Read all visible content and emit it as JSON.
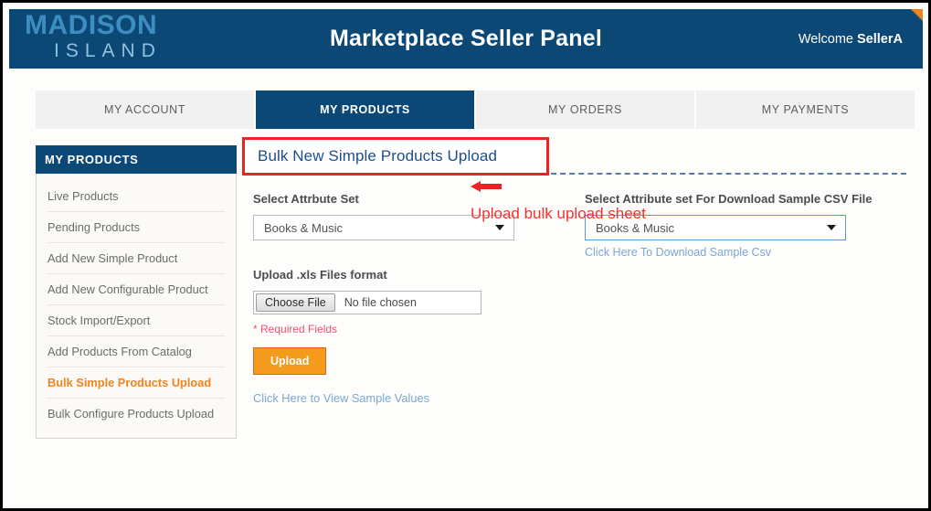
{
  "header": {
    "logo_main": "MADISON",
    "logo_sub": "ISLAND",
    "title": "Marketplace Seller Panel",
    "welcome_prefix": "Welcome ",
    "welcome_user": "SellerA",
    "bg_color": "#0c4876",
    "corner_accent_color": "#f08421"
  },
  "tabs": [
    {
      "label": "MY ACCOUNT",
      "active": false
    },
    {
      "label": "MY PRODUCTS",
      "active": true
    },
    {
      "label": "MY ORDERS",
      "active": false
    },
    {
      "label": "MY PAYMENTS",
      "active": false
    }
  ],
  "sidebar": {
    "heading": "MY PRODUCTS",
    "items": [
      {
        "label": "Live Products",
        "current": false
      },
      {
        "label": "Pending Products",
        "current": false
      },
      {
        "label": "Add New Simple Product",
        "current": false
      },
      {
        "label": "Add New Configurable Product",
        "current": false
      },
      {
        "label": "Stock Import/Export",
        "current": false
      },
      {
        "label": "Add Products From Catalog",
        "current": false
      },
      {
        "label": "Bulk Simple Products Upload",
        "current": true
      },
      {
        "label": "Bulk Configure Products Upload",
        "current": false
      }
    ],
    "current_color": "#f08421"
  },
  "main": {
    "page_title": "Bulk New Simple Products Upload",
    "page_title_highlight_color": "#ee2222",
    "attribute_set": {
      "label": "Select Attrbute Set",
      "value": "Books & Music"
    },
    "download_attribute_set": {
      "label": "Select Attribute set For Download Sample CSV File",
      "value": "Books & Music",
      "link": "Click Here To Download Sample Csv"
    },
    "upload": {
      "label": "Upload .xls Files format",
      "choose_button": "Choose File",
      "file_name": "No file chosen",
      "required_note": "* Required Fields",
      "submit_button": "Upload",
      "submit_color": "#f49a1c"
    },
    "sample_values_link": "Click Here to View Sample Values"
  },
  "annotation": {
    "text": "Upload bulk upload sheet",
    "color": "#fa2f2f",
    "icon": "arrow-left-icon"
  }
}
